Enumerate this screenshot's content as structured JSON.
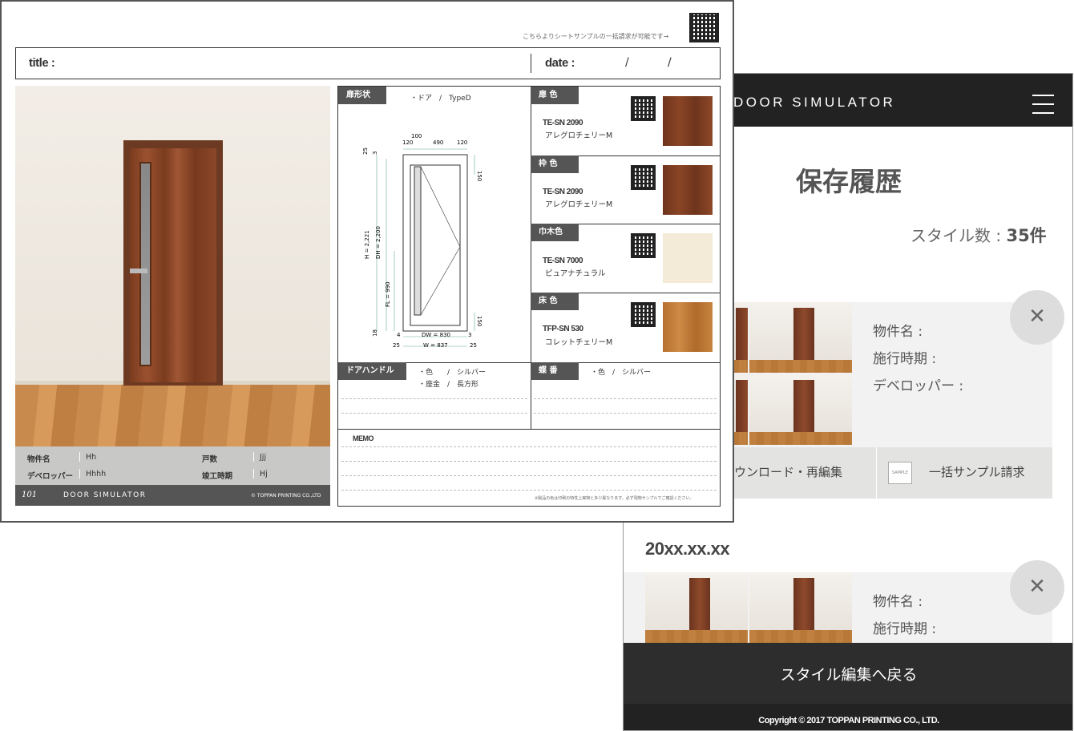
{
  "phone": {
    "brand": "DOOR SIMULATOR",
    "title": "保存履歴",
    "count_label": "スタイル数 : ",
    "count_value": "35件",
    "card_fields": [
      "物件名 :",
      "施行時期 :",
      "デベロッパー :"
    ],
    "card2_fields": [
      "物件名 :",
      "施行時期 :"
    ],
    "action_download": "ウンロード・再編集",
    "action_sample": "一括サンプル請求",
    "sample_icon_text": "SAMPLE",
    "date": "20xx.xx.xx",
    "back_label": "スタイル編集へ戻る",
    "copyright": "Copyright © 2017 TOPPAN PRINTING CO., LTD."
  },
  "sheet": {
    "qr_note": "こちらよりシートサンプルの一括請求が可能です→",
    "title_label": "title :",
    "date_label": "date :",
    "date_slash1": "/",
    "date_slash2": "/",
    "info": {
      "property_label": "物件名",
      "property_value": "Hh",
      "units_label": "戸数",
      "units_value": "Jjj",
      "developer_label": "デベロッパー",
      "developer_value": "Hhhh",
      "completion_label": "竣工時期",
      "completion_value": "Hj"
    },
    "brand_logo": "101",
    "brand": "DOOR SIMULATOR",
    "copyright": "© TOPPAN PRINTING CO.,LTD",
    "shape_label": "扉形状",
    "shape_value": "・ドア　/　TypeD",
    "drawing": {
      "top_dims": [
        "100",
        "120",
        "490",
        "120"
      ],
      "side_dims": [
        "25",
        "3",
        "H = 2,221",
        "DH = 2,200",
        "FL = 990",
        "18"
      ],
      "right_dims": [
        "150",
        "150"
      ],
      "bottom_dims": [
        "4",
        "DW = 830",
        "3",
        "25",
        "W = 837",
        "25"
      ]
    },
    "materials": [
      {
        "label": "扉 色",
        "code": "TE-SN 2090",
        "name": "アレグロチェリーM",
        "color": "#7a3b1e"
      },
      {
        "label": "枠 色",
        "code": "TE-SN 2090",
        "name": "アレグロチェリーM",
        "color": "#7a3b1e"
      },
      {
        "label": "巾木色",
        "code": "TE-SN 7000",
        "name": "ピュアナチュラル",
        "color": "#f3ead7"
      },
      {
        "label": "床 色",
        "code": "TFP-SN 530",
        "name": "コレットチェリーM",
        "color": "#c07a38"
      }
    ],
    "handle_label": "ドアハンドル",
    "handle_line1": "・色　　/　シルバー",
    "handle_line2": "・座金　/　長方形",
    "hinge_label": "蝶 番",
    "hinge_line1": "・色　/　シルバー",
    "memo_label": "MEMO",
    "footnote": "※製品の色は印刷の特性上実物と多少異なります。必ず現物サンプルでご確認ください。"
  },
  "colors": {
    "dark": "#222222",
    "label_bg": "#555555",
    "card_bg": "#f2f2f2"
  }
}
